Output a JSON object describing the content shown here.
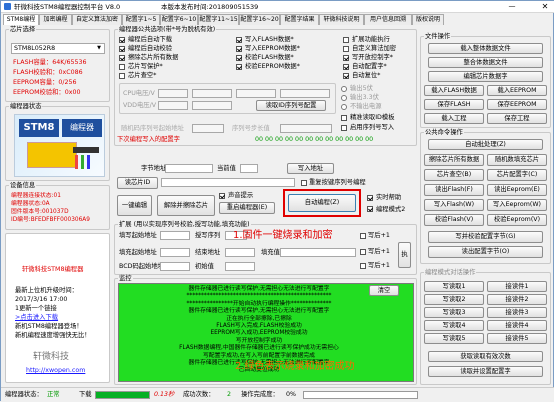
{
  "title": "轩微科技STM8编程器控制平台 V8.0",
  "release": "本版本发布时间:201809051539",
  "tabs": [
    "STM8编程",
    "加密编程",
    "自定义算法加密",
    "配置字1~5",
    "配置字6~10",
    "配置字11~15",
    "配置字16~20",
    "配置字结果",
    "轩微科技说明",
    "用户信息回溯",
    "版权说明"
  ],
  "chip": {
    "section": "芯片选择",
    "model": "STM8L052R8",
    "flash": "FLASH容量：64K/65536",
    "checksum": "FLASH校验和：0xC086",
    "eeprom": "EEPROM容量：0/256",
    "eeprom_sum": "EEPROM校验和：0x00"
  },
  "status_section": "编程器状态",
  "device": {
    "section": "设备信息",
    "l1": "编程器连接状态:01",
    "l2": "编程器状态:0A",
    "l3": "固件版本号:001037D",
    "l4": "ID编号:BFEDFBFF000306A9"
  },
  "links": {
    "official": "轩微科技STM8编程器",
    "website": "http://xwopen.com"
  },
  "news": {
    "l1": "最新上位机升级时间：",
    "l2": "2017/3/16  17:00",
    "l3": "1更新一个链接",
    "l4": ">点击进入下载",
    "l5": "新机STM8编程器登场！",
    "l6": "新机编程速度增强快无比！"
  },
  "company": "轩微科技",
  "options": {
    "section": "编程器公共选项(带*号为脱机有效)",
    "left": [
      "编程后自动下载",
      "编程后自动校验",
      "擦除芯片所有数据",
      "芯片写保护*",
      "芯片查空*"
    ],
    "mid": [
      "写入FLASH数据*",
      "写入EEPROM数据*",
      "校验FLASH数据*",
      "校验EEPROM数据*"
    ],
    "right": [
      "扩展功能执行",
      "自定义算法加密",
      "写开放控制字*",
      "自动配置字*",
      "自动复位*"
    ]
  },
  "serial": {
    "gen_label": "按序列号生成加密",
    "enable_label": "启用序列号写入"
  },
  "params": {
    "voltage_label": "CPU电压/V",
    "vdd_label": "VDD电压/V",
    "v_opts": [
      "输出5伏",
      "输出3.3伏",
      "不输出电源"
    ],
    "count_btn": "读取ID序列号配置",
    "data_flash": "数据存储器电压设置",
    "lock_label": "精准读取ID模板"
  },
  "serial_disabled": {
    "l1": "随机码序列号起始地址",
    "l2": "序列号步长值"
  },
  "gen_row": "下次编程写入的配置字",
  "gen_value": "00 00 00 00 00 00 00 00 00 00 00 00",
  "char_addr": "字节地址",
  "cur_addr": "当前值",
  "write_addr_btn": "写入地址",
  "read_btn": "读芯片ID",
  "quick": {
    "label": "一键编辑",
    "b1": "解除并擦除芯片",
    "b2": "重启编程器(E)",
    "cb1": "声音提示",
    "cb2": "每次编程前读ID",
    "auto": "自动编程(Z)",
    "rt": "实时帮助",
    "mode": "编程模式2",
    "repeat": "重复按键序列号编程"
  },
  "expand": {
    "section": "扩展 (用以实现序列号校验,授写功能,填充功能)",
    "f1": "填写起始地址",
    "f2": "授写序列",
    "f3": "写入偏移",
    "f4": "填充起始地址",
    "f5": "结束地址",
    "f6": "填充值",
    "f7": "BCD码起始地址",
    "f8": "初始值",
    "exec": "执行",
    "r1": "写后+1",
    "r2": "写后+1",
    "r3": "写后+1"
  },
  "annotations": {
    "a1": "1.固件一键烧录和加密",
    "a2": "2.绿色表示烧录和加密成功"
  },
  "log": {
    "section": "监控",
    "clear": "清空",
    "lines": [
      "器件存储器已进行读写保护,无需担心无法进行写配置字",
      "**************************************************",
      "****************开始自动执行编程操作**************",
      "器件存储器已进行读写保护,无需担心无法进行写配置字",
      "正在执行全部擦除,已擦除",
      "FLASH写入完成,FLASH校验成功",
      "EEPROM写入成功,EEPROM校验成功",
      "写开放控制字成功",
      "FLASH数据编程,中国器件存储器已进行读写保护成功无需担心",
      "写配置字成功,在写入写前配置字前数据完成",
      "器件存储器已进行读写保护,无需担心无法进行写配置字",
      "已自动复位成功"
    ]
  },
  "status": {
    "state_label": "编程器状态：",
    "state": "正常",
    "download": "下载",
    "time": "0.13秒",
    "success_label": "成功次数：",
    "success": "2",
    "done_label": "操作完成度：",
    "done": "0%"
  },
  "files": {
    "section": "文件操作",
    "b1": "载入整体数据文件",
    "b2": "整合体数据文件",
    "b3": "编辑芯片数据字",
    "b4": "载入FLASH数据",
    "b5": "载入EEPROM",
    "b6": "保存FLASH",
    "b7": "保存EEPROM",
    "b8": "载入工程",
    "b9": "保存工程"
  },
  "common": {
    "section": "公共命令操作",
    "auto": "自动批处理(Z)",
    "erase": "擦除芯片所有数据",
    "rand": "随机数填充芯片",
    "blank": "芯片查空(B)",
    "cfg": "芯片配置字(C)",
    "rflash": "读出Flash(F)",
    "reeprom": "读出Eeprom(E)",
    "wflash": "写入Flash(W)",
    "weeprom": "写入Eeprom(W)",
    "vflash": "校验Flash(V)",
    "veeprom": "校验Eeprom(V)",
    "wcfg": "写并校验配置字节(G)",
    "rcfg": "读出配置字节(O)"
  },
  "special": {
    "section": "编程模式对话操作",
    "items": [
      "写读取1",
      "接读件1",
      "写读取2",
      "接读件2",
      "写读取3",
      "接读件3",
      "写读取4",
      "接读件4",
      "写读取5",
      "接读件5"
    ],
    "get": "获取读取有效次数",
    "cfg": "读取并设置配置字"
  },
  "colors": {
    "green": "#22dd22",
    "red": "#e00000",
    "blue": "#1a1aff",
    "orange": "#ff6600"
  }
}
